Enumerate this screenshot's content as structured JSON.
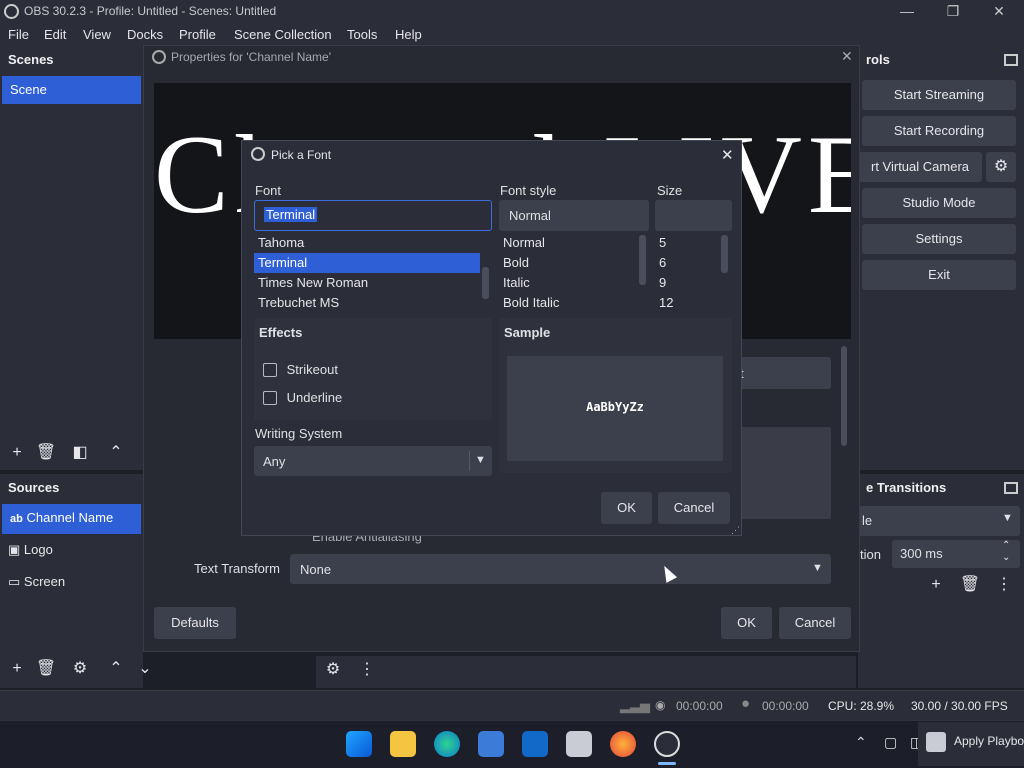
{
  "window": {
    "title": "OBS 30.2.3 - Profile: Untitled - Scenes: Untitled",
    "minimize": "—",
    "maximize": "❐",
    "close": "✕"
  },
  "menu": [
    "File",
    "Edit",
    "View",
    "Docks",
    "Profile",
    "Scene Collection",
    "Tools",
    "Help"
  ],
  "scenes": {
    "title": "Scenes",
    "items": [
      "Scene"
    ]
  },
  "sources": {
    "title": "Sources",
    "items": [
      {
        "icon": "ab",
        "label": "Channel Name"
      },
      {
        "icon": "▣",
        "label": "Logo"
      },
      {
        "icon": "▭",
        "label": "Screen"
      }
    ]
  },
  "controls": {
    "title_fragment": "rols",
    "start_streaming": "Start Streaming",
    "start_recording": "Start Recording",
    "virtual_camera": "rt Virtual Camera",
    "studio_mode": "Studio Mode",
    "settings": "Settings",
    "exit": "Exit"
  },
  "transitions": {
    "title_fragment": "e Transitions",
    "type_fragment": "le",
    "duration_label_fragment": "tion",
    "duration_value": "300 ms"
  },
  "properties": {
    "title": "Properties for 'Channel Name'",
    "preview_text": "Channel LIVE TV",
    "partial_button_text": "t",
    "antialiasing_partial": "Enable Antialiasing",
    "text_transform_label": "Text Transform",
    "text_transform_value": "None",
    "defaults": "Defaults",
    "ok": "OK",
    "cancel": "Cancel"
  },
  "font_picker": {
    "title": "Pick a Font",
    "font_label": "Font",
    "font_input": "Terminal",
    "fonts": [
      "Tahoma",
      "Terminal",
      "Times New Roman",
      "Trebuchet MS"
    ],
    "selected_font_index": 1,
    "style_label": "Font style",
    "style_input": "Normal",
    "styles": [
      "Normal",
      "Bold",
      "Italic",
      "Bold Italic"
    ],
    "size_label": "Size",
    "size_input": "",
    "sizes": [
      "5",
      "6",
      "9",
      "12"
    ],
    "effects_label": "Effects",
    "strikeout": "Strikeout",
    "underline": "Underline",
    "writing_system_label": "Writing System",
    "writing_system_value": "Any",
    "sample_label": "Sample",
    "sample_text": "AaBbYyZz",
    "ok": "OK",
    "cancel": "Cancel"
  },
  "status": {
    "stream_time": "00:00:00",
    "record_time": "00:00:00",
    "cpu": "CPU: 28.9%",
    "fps": "30.00 / 30.00 FPS"
  },
  "taskbar": {
    "notification_text": "Apply Playbo"
  },
  "colors": {
    "accent": "#2f5fd6",
    "bg": "#1d1f26",
    "panel": "#2b2e38",
    "button": "#3c404d"
  }
}
